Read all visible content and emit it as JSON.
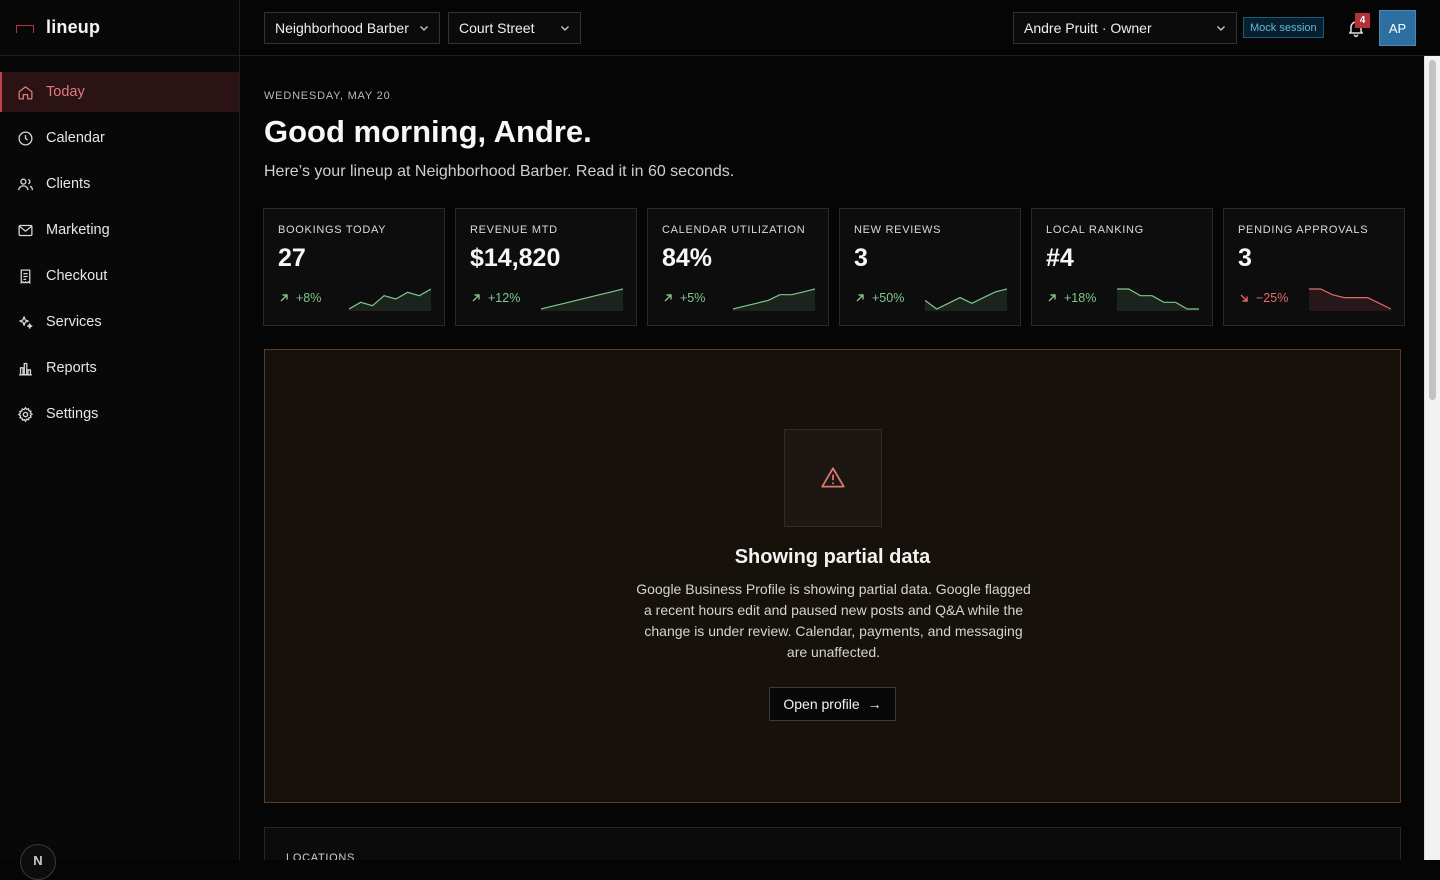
{
  "app": {
    "name": "lineup"
  },
  "sidebar": {
    "items": [
      {
        "label": "Today",
        "icon": "home-icon",
        "active": true
      },
      {
        "label": "Calendar",
        "icon": "clock-icon"
      },
      {
        "label": "Clients",
        "icon": "users-icon"
      },
      {
        "label": "Marketing",
        "icon": "mail-icon"
      },
      {
        "label": "Checkout",
        "icon": "receipt-icon"
      },
      {
        "label": "Services",
        "icon": "sparkle-icon"
      },
      {
        "label": "Reports",
        "icon": "bar-chart-icon"
      },
      {
        "label": "Settings",
        "icon": "gear-icon"
      }
    ],
    "footer_initial": "N"
  },
  "topbar": {
    "business": "Neighborhood Barber",
    "location": "Court Street",
    "user": "Andre Pruitt · Owner",
    "session_badge": "Mock session",
    "notification_count": "4",
    "avatar_initials": "AP"
  },
  "header": {
    "date": "WEDNESDAY, MAY 20",
    "greeting": "Good morning, Andre.",
    "subline": "Here’s your lineup at Neighborhood Barber. Read it in 60 seconds."
  },
  "kpis": [
    {
      "label": "BOOKINGS TODAY",
      "value": "27",
      "delta": "+8%",
      "trend": "up",
      "spark": [
        3,
        5,
        4,
        7,
        6,
        8,
        7,
        9
      ]
    },
    {
      "label": "REVENUE MTD",
      "value": "$14,820",
      "delta": "+12%",
      "trend": "up",
      "spark": [
        2,
        3,
        4,
        5,
        6,
        7,
        8,
        9
      ]
    },
    {
      "label": "CALENDAR UTILIZATION",
      "value": "84%",
      "delta": "+5%",
      "trend": "up",
      "spark": [
        2,
        3,
        4,
        5,
        7,
        7,
        8,
        9
      ]
    },
    {
      "label": "NEW REVIEWS",
      "value": "3",
      "delta": "+50%",
      "trend": "up",
      "spark": [
        6,
        3,
        5,
        7,
        5,
        7,
        9,
        10
      ]
    },
    {
      "label": "LOCAL RANKING",
      "value": "#4",
      "delta": "+18%",
      "trend": "up",
      "spark": [
        9,
        9,
        7,
        7,
        5,
        5,
        3,
        3
      ]
    },
    {
      "label": "PENDING APPROVALS",
      "value": "3",
      "delta": "−25%",
      "trend": "down",
      "spark": [
        9,
        9,
        7,
        6,
        6,
        6,
        4,
        2
      ]
    }
  ],
  "alert": {
    "icon": "warning-icon",
    "title": "Showing partial data",
    "body": "Google Business Profile is showing partial data. Google flagged a recent hours edit and paused new posts and Q&A while the change is under review. Calendar, payments, and messaging are unaffected.",
    "button": "Open profile",
    "button_arrow": "→"
  },
  "locations": {
    "label": "LOCATIONS"
  },
  "colors": {
    "accent": "#c0434a",
    "up": "#7fc68e",
    "down": "#e26b6b",
    "avatar": "#2e6fa1"
  }
}
